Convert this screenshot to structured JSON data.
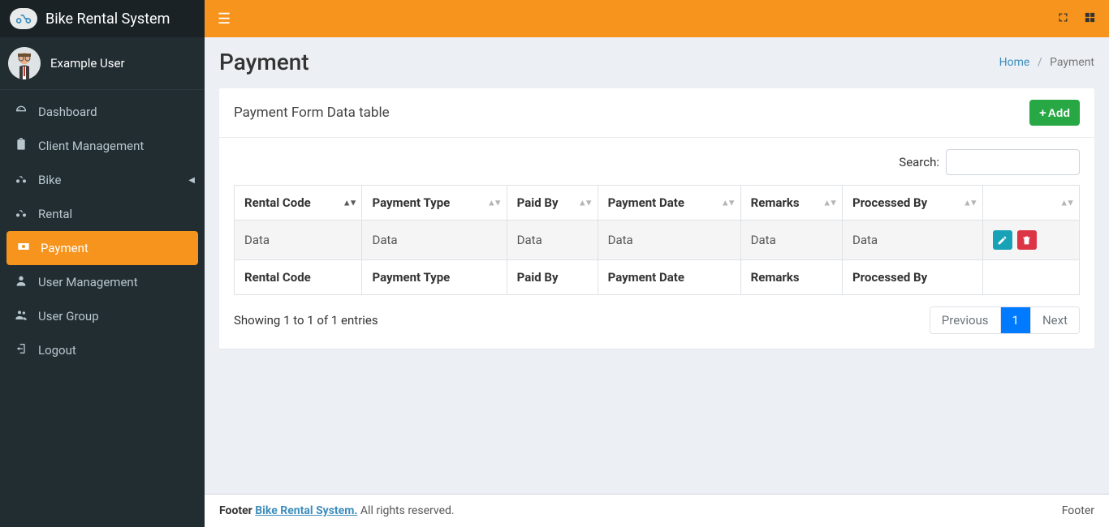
{
  "brand": {
    "name": "Bike Rental System"
  },
  "user": {
    "name": "Example User"
  },
  "sidebar": {
    "items": [
      {
        "label": "Dashboard",
        "icon": "dashboard-icon"
      },
      {
        "label": "Client Management",
        "icon": "clipboard-icon"
      },
      {
        "label": "Bike",
        "icon": "bike-icon",
        "hasSubmenu": true
      },
      {
        "label": "Rental",
        "icon": "bike-icon"
      },
      {
        "label": "Payment",
        "icon": "money-icon",
        "active": true
      },
      {
        "label": "User Management",
        "icon": "user-icon"
      },
      {
        "label": "User Group",
        "icon": "users-icon"
      },
      {
        "label": "Logout",
        "icon": "logout-icon"
      }
    ]
  },
  "page": {
    "title": "Payment",
    "breadcrumb": {
      "home": "Home",
      "current": "Payment"
    }
  },
  "panel": {
    "title": "Payment Form Data table",
    "add_label": "Add",
    "search_label": "Search:"
  },
  "table": {
    "headers": [
      "Rental Code",
      "Payment Type",
      "Paid By",
      "Payment Date",
      "Remarks",
      "Processed By"
    ],
    "rows": [
      [
        "Data",
        "Data",
        "Data",
        "Data",
        "Data",
        "Data"
      ]
    ],
    "footers": [
      "Rental Code",
      "Payment Type",
      "Paid By",
      "Payment Date",
      "Remarks",
      "Processed By"
    ],
    "entries_info": "Showing 1 to 1 of 1 entries",
    "pagination": {
      "previous": "Previous",
      "next": "Next",
      "current": "1"
    }
  },
  "footer": {
    "left_prefix": "Footer ",
    "brand": "Bike Rental System.",
    "rights": " All rights reserved.",
    "right": "Footer"
  }
}
